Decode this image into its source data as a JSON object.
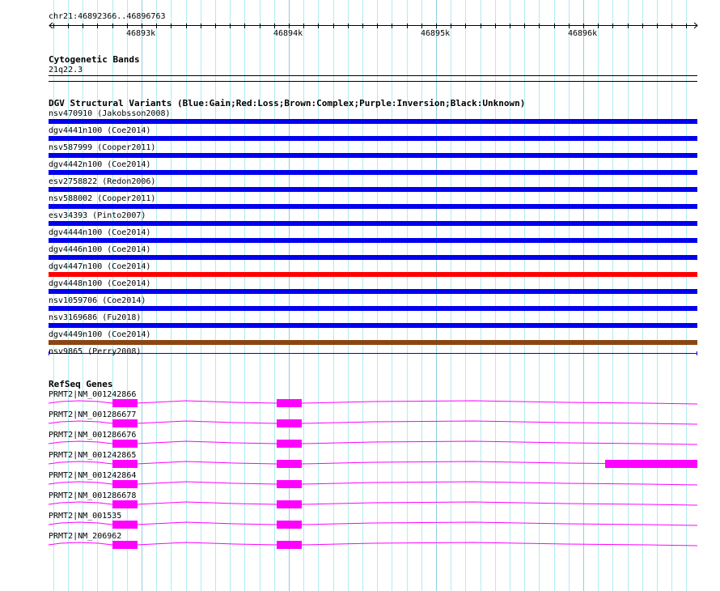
{
  "ruler": {
    "region": "chr21:46892366..46896763",
    "ticks": [
      "46893k",
      "46894k",
      "46895k",
      "46896k"
    ]
  },
  "cytoband": {
    "title": "Cytogenetic Bands",
    "band": "21q22.3"
  },
  "dgv": {
    "title": "DGV Structural Variants (Blue:Gain;Red:Loss;Brown:Complex;Purple:Inversion;Black:Unknown)",
    "colors": {
      "gain": "#0000ee",
      "loss": "#ff0000",
      "complex": "#8b4513",
      "unknown": "#000000"
    },
    "items": [
      {
        "label": "nsv470910 (Jakobsson2008)",
        "type": "gain"
      },
      {
        "label": "dgv4441n100 (Coe2014)",
        "type": "gain"
      },
      {
        "label": "nsv587999 (Cooper2011)",
        "type": "gain"
      },
      {
        "label": "dgv4442n100 (Coe2014)",
        "type": "gain"
      },
      {
        "label": "esv2758822 (Redon2006)",
        "type": "gain"
      },
      {
        "label": "nsv588002 (Cooper2011)",
        "type": "gain"
      },
      {
        "label": "esv34393 (Pinto2007)",
        "type": "gain"
      },
      {
        "label": "dgv4444n100 (Coe2014)",
        "type": "gain"
      },
      {
        "label": "dgv4446n100 (Coe2014)",
        "type": "gain"
      },
      {
        "label": "dgv4447n100 (Coe2014)",
        "type": "loss"
      },
      {
        "label": "dgv4448n100 (Coe2014)",
        "type": "gain"
      },
      {
        "label": "nsv1059706 (Coe2014)",
        "type": "gain"
      },
      {
        "label": "nsv3169686 (Fu2018)",
        "type": "gain"
      },
      {
        "label": "dgv4449n100 (Coe2014)",
        "type": "complex"
      },
      {
        "label": "nsv9865 (Perry2008)",
        "type": "line"
      }
    ]
  },
  "refseq": {
    "title": "RefSeq Genes",
    "color": "#ff00ff",
    "genes": [
      {
        "label": "PRMT2|NM_001242866",
        "extra_exon": false
      },
      {
        "label": "PRMT2|NM_001286677",
        "extra_exon": false
      },
      {
        "label": "PRMT2|NM_001286676",
        "extra_exon": false
      },
      {
        "label": "PRMT2|NM_001242865",
        "extra_exon": true
      },
      {
        "label": "PRMT2|NM_001242864",
        "extra_exon": false
      },
      {
        "label": "PRMT2|NM_001286678",
        "extra_exon": false
      },
      {
        "label": "PRMT2|NM_001535",
        "extra_exon": false
      },
      {
        "label": "PRMT2|NM_206962",
        "extra_exon": false
      }
    ]
  }
}
